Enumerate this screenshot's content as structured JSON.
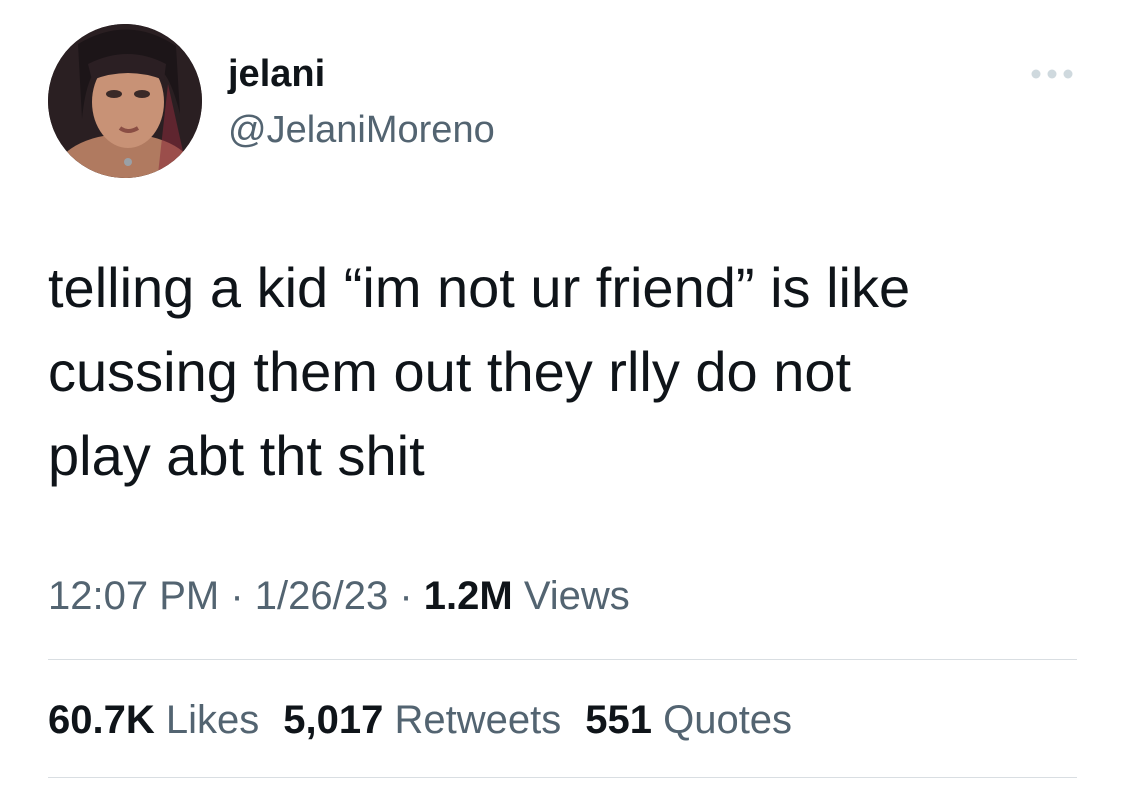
{
  "author": {
    "display_name": "jelani",
    "handle": "@JelaniMoreno",
    "avatar_icon": "profile-photo"
  },
  "more_icon": "ellipsis-icon",
  "tweet": {
    "text": "telling a kid “im not ur friend” is like\ncussing them out they rlly do not\nplay abt tht shit",
    "time": "12:07 PM",
    "separator": " · ",
    "date": "1/26/23",
    "views_count": "1.2M",
    "views_label": " Views"
  },
  "stats": {
    "likes_count": "60.7K",
    "likes_label": " Likes",
    "retweets_count": "5,017",
    "retweets_label": " Retweets",
    "quotes_count": "551",
    "quotes_label": " Quotes"
  },
  "colors": {
    "primary_text": "#0f1419",
    "secondary_text": "#536471",
    "divider": "#d9dee2"
  }
}
